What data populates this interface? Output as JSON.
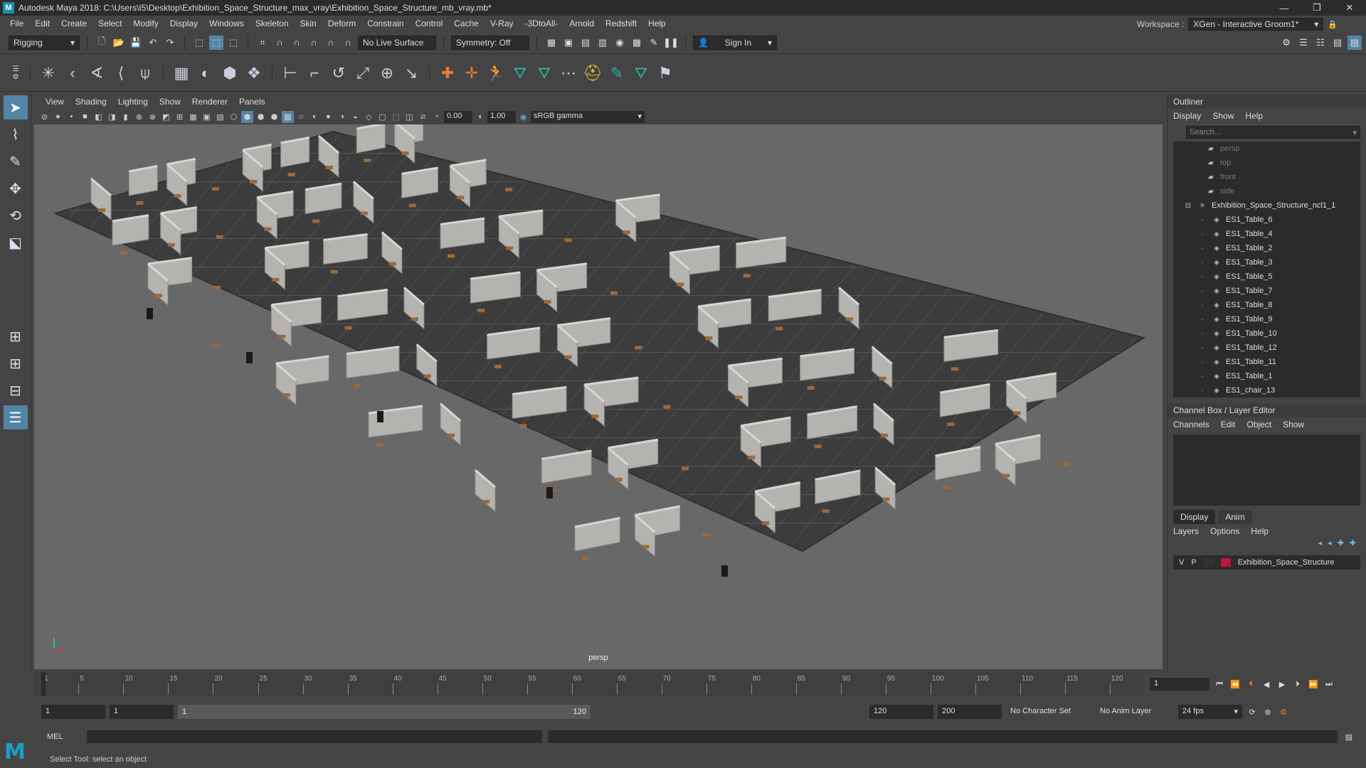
{
  "window": {
    "title": "Autodesk Maya 2018: C:\\Users\\I5\\Desktop\\Exhibition_Space_Structure_max_vray\\Exhibition_Space_Structure_mb_vray.mb*",
    "minimize": "—",
    "maximize": "❐",
    "close": "✕"
  },
  "menu": [
    "File",
    "Edit",
    "Create",
    "Select",
    "Modify",
    "Display",
    "Windows",
    "Skeleton",
    "Skin",
    "Deform",
    "Constrain",
    "Control",
    "Cache",
    "V-Ray",
    "-3DtoAll-",
    "Arnold",
    "Redshift",
    "Help"
  ],
  "workspace": {
    "label": "Workspace :",
    "value": "XGen - Interactive Groom1*"
  },
  "statusline": {
    "mode": "Rigging",
    "live_surface": "No Live Surface",
    "symmetry": "Symmetry: Off",
    "sign_in": "Sign In"
  },
  "viewport": {
    "menus": [
      "View",
      "Shading",
      "Lighting",
      "Show",
      "Renderer",
      "Panels"
    ],
    "exposure": "0.00",
    "gamma": "1.00",
    "color_space": "sRGB gamma",
    "camera": "persp"
  },
  "outliner": {
    "title": "Outliner",
    "menus": [
      "Display",
      "Show",
      "Help"
    ],
    "search_placeholder": "Search...",
    "items": [
      {
        "label": "persp",
        "dim": true,
        "indent": 1,
        "icon": "camera-icon"
      },
      {
        "label": "top",
        "dim": true,
        "indent": 1,
        "icon": "camera-icon"
      },
      {
        "label": "front",
        "dim": true,
        "indent": 1,
        "icon": "camera-icon"
      },
      {
        "label": "side",
        "dim": true,
        "indent": 1,
        "icon": "camera-icon"
      },
      {
        "label": "Exhibition_Space_Structure_ncl1_1",
        "dim": false,
        "indent": 0,
        "icon": "group-icon"
      },
      {
        "label": "ES1_Table_6",
        "dim": false,
        "indent": 2,
        "icon": "mesh-icon"
      },
      {
        "label": "ES1_Table_4",
        "dim": false,
        "indent": 2,
        "icon": "mesh-icon"
      },
      {
        "label": "ES1_Table_2",
        "dim": false,
        "indent": 2,
        "icon": "mesh-icon"
      },
      {
        "label": "ES1_Table_3",
        "dim": false,
        "indent": 2,
        "icon": "mesh-icon"
      },
      {
        "label": "ES1_Table_5",
        "dim": false,
        "indent": 2,
        "icon": "mesh-icon"
      },
      {
        "label": "ES1_Table_7",
        "dim": false,
        "indent": 2,
        "icon": "mesh-icon"
      },
      {
        "label": "ES1_Table_8",
        "dim": false,
        "indent": 2,
        "icon": "mesh-icon"
      },
      {
        "label": "ES1_Table_9",
        "dim": false,
        "indent": 2,
        "icon": "mesh-icon"
      },
      {
        "label": "ES1_Table_10",
        "dim": false,
        "indent": 2,
        "icon": "mesh-icon"
      },
      {
        "label": "ES1_Table_12",
        "dim": false,
        "indent": 2,
        "icon": "mesh-icon"
      },
      {
        "label": "ES1_Table_11",
        "dim": false,
        "indent": 2,
        "icon": "mesh-icon"
      },
      {
        "label": "ES1_Table_1",
        "dim": false,
        "indent": 2,
        "icon": "mesh-icon"
      },
      {
        "label": "ES1_chair_13",
        "dim": false,
        "indent": 2,
        "icon": "mesh-icon"
      }
    ]
  },
  "channel_box": {
    "title": "Channel Box / Layer Editor",
    "menus": [
      "Channels",
      "Edit",
      "Object",
      "Show"
    ]
  },
  "layer_editor": {
    "tabs": [
      "Display",
      "Anim"
    ],
    "menus": [
      "Layers",
      "Options",
      "Help"
    ],
    "layer": {
      "v": "V",
      "p": "P",
      "name": "Exhibition_Space_Structure",
      "color": "#c0143a"
    }
  },
  "timeline": {
    "ticks": [
      1,
      5,
      10,
      15,
      20,
      25,
      30,
      35,
      40,
      45,
      50,
      55,
      60,
      65,
      70,
      75,
      80,
      85,
      90,
      95,
      100,
      105,
      110,
      115,
      120
    ],
    "current_frame": "1"
  },
  "range": {
    "start": "1",
    "anim_start": "1",
    "slider_start": "1",
    "slider_end": "120",
    "end": "120",
    "anim_end": "200",
    "character_set": "No Character Set",
    "anim_layer": "No Anim Layer",
    "fps": "24 fps"
  },
  "command": {
    "label": "MEL"
  },
  "help_line": "Select Tool: select an object",
  "colors": {
    "accent": "#5285a6",
    "logo": "#1b9fc6"
  }
}
